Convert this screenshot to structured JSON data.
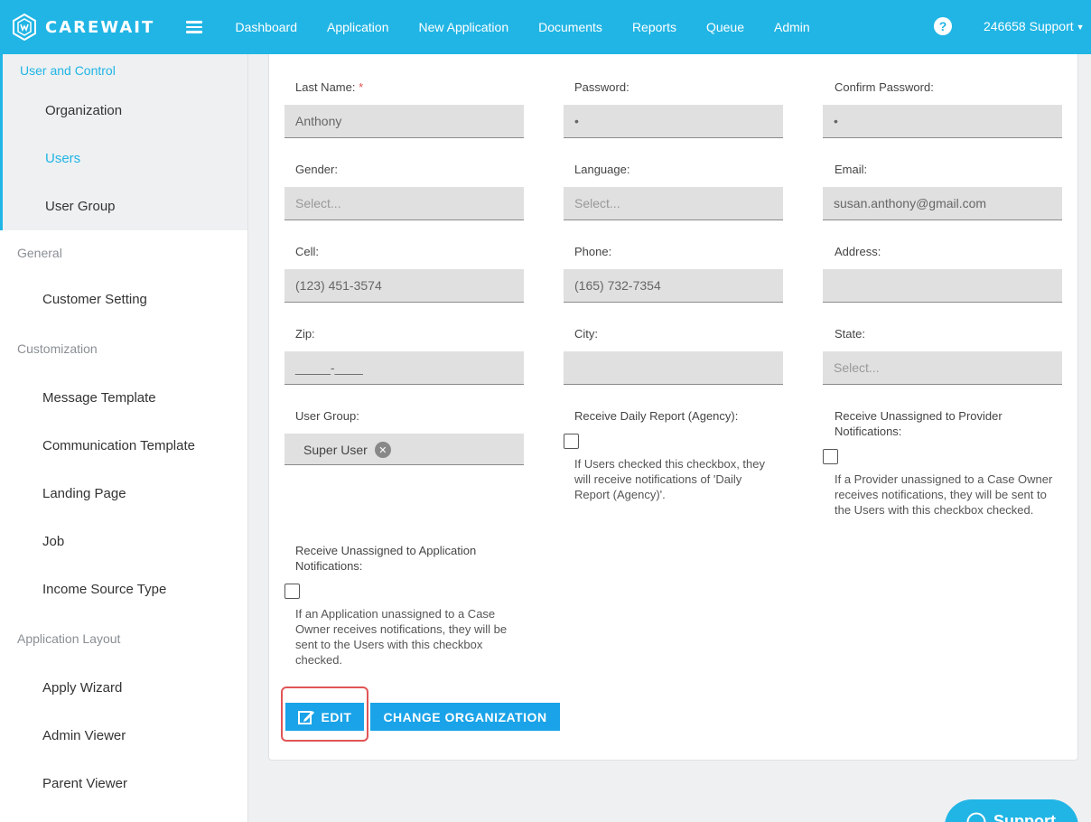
{
  "app": {
    "logo_text": "CAREWAIT"
  },
  "nav": {
    "items": [
      "Dashboard",
      "Application",
      "New Application",
      "Documents",
      "Reports",
      "Queue",
      "Admin"
    ],
    "help_glyph": "?",
    "user_label": "246658 Support",
    "user_caret": "▼"
  },
  "sidebar": {
    "sections": [
      {
        "heading": "User and Control",
        "items": [
          "Organization",
          "Users",
          "User Group"
        ],
        "active_item": "Users"
      },
      {
        "heading": "General",
        "items": [
          "Customer Setting"
        ]
      },
      {
        "heading": "Customization",
        "items": [
          "Message Template",
          "Communication Template",
          "Landing Page",
          "Job",
          "Income Source Type"
        ]
      },
      {
        "heading": "Application Layout",
        "items": [
          "Apply Wizard",
          "Admin Viewer",
          "Parent Viewer"
        ]
      }
    ]
  },
  "form": {
    "last_name": {
      "label": "Last Name:",
      "required_mark": "*",
      "value": "Anthony"
    },
    "password": {
      "label": "Password:",
      "value": "•"
    },
    "confirm_password": {
      "label": "Confirm Password:",
      "value": "•"
    },
    "gender": {
      "label": "Gender:",
      "placeholder": "Select..."
    },
    "language": {
      "label": "Language:",
      "placeholder": "Select..."
    },
    "email": {
      "label": "Email:",
      "value": "susan.anthony@gmail.com"
    },
    "cell": {
      "label": "Cell:",
      "value": "(123) 451-3574"
    },
    "phone": {
      "label": "Phone:",
      "value": "(165) 732-7354"
    },
    "address": {
      "label": "Address:",
      "value": ""
    },
    "zip": {
      "label": "Zip:",
      "value": "_____-____"
    },
    "city": {
      "label": "City:",
      "value": ""
    },
    "state": {
      "label": "State:",
      "placeholder": "Select..."
    },
    "user_group": {
      "label": "User Group:",
      "chip": "Super User",
      "chip_remove": "✕"
    },
    "daily_report": {
      "label": "Receive Daily Report (Agency):",
      "checked": false,
      "help": "If Users checked this checkbox, they will receive notifications of 'Daily Report (Agency)'."
    },
    "unassigned_provider": {
      "label": "Receive Unassigned to Provider Notifications:",
      "checked": false,
      "help": "If a Provider unassigned to a Case Owner receives notifications, they will be sent to the Users with this checkbox checked."
    },
    "unassigned_application": {
      "label": "Receive Unassigned to Application Notifications:",
      "checked": false,
      "help": "If an Application unassigned to a Case Owner receives notifications, they will be sent to the Users with this checkbox checked."
    }
  },
  "buttons": {
    "edit": "EDIT",
    "change_org": "CHANGE ORGANIZATION"
  },
  "support": {
    "label": "Support"
  },
  "colors": {
    "brand": "#21b5e5",
    "button": "#1aa3e8",
    "highlight": "#e05555"
  }
}
